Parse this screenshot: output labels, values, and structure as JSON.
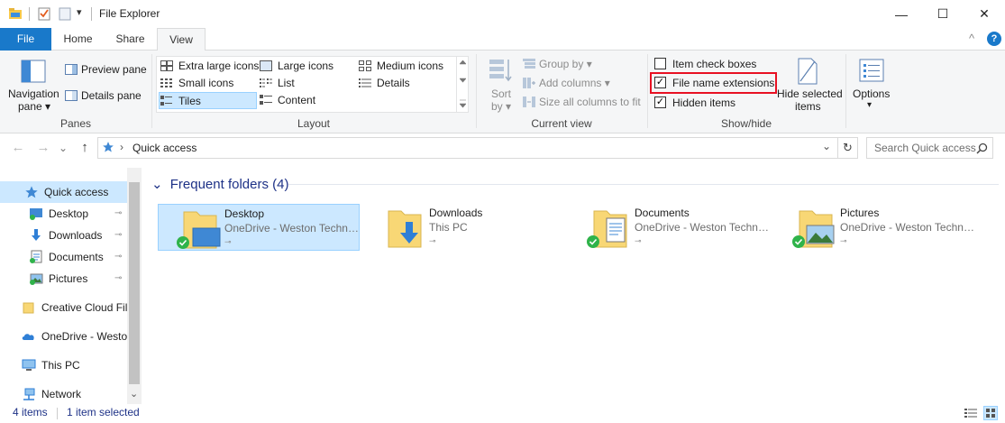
{
  "window": {
    "title": "File Explorer",
    "minimize": "—",
    "maximize": "☐",
    "close": "✕",
    "qat_dropdown": "▾"
  },
  "tabs": {
    "file": "File",
    "home": "Home",
    "share": "Share",
    "view": "View",
    "collapse": "^",
    "help": "?"
  },
  "ribbon": {
    "panes": {
      "navigation_pane_line1": "Navigation",
      "navigation_pane_line2": "pane ▾",
      "preview_pane": "Preview pane",
      "details_pane": "Details pane",
      "group_label": "Panes"
    },
    "layout": {
      "extra_large_icons": "Extra large icons",
      "large_icons": "Large icons",
      "medium_icons": "Medium icons",
      "small_icons": "Small icons",
      "list": "List",
      "details": "Details",
      "tiles": "Tiles",
      "content": "Content",
      "group_label": "Layout"
    },
    "current_view": {
      "sort_by_line1": "Sort",
      "sort_by_line2": "by ▾",
      "group_by": "Group by ▾",
      "add_columns": "Add columns ▾",
      "size_all_columns": "Size all columns to fit",
      "group_label": "Current view"
    },
    "show_hide": {
      "item_check_boxes": "Item check boxes",
      "item_check_boxes_checked": false,
      "file_name_extensions": "File name extensions",
      "file_name_extensions_checked": true,
      "hidden_items": "Hidden items",
      "hidden_items_checked": true,
      "hide_selected_line1": "Hide selected",
      "hide_selected_line2": "items",
      "group_label": "Show/hide",
      "highlight_color": "#e81123"
    },
    "options": {
      "label": "Options",
      "arrow": "▾"
    }
  },
  "address_bar": {
    "back": "←",
    "forward": "→",
    "recent": "⌄",
    "up": "↑",
    "path_separator": "›",
    "path": "Quick access",
    "dropdown": "⌄",
    "refresh": "↻",
    "search_placeholder": "Search Quick access"
  },
  "sidebar": {
    "items": [
      {
        "label": "Quick access",
        "icon": "star-icon"
      },
      {
        "label": "Desktop",
        "icon": "desktop-icon",
        "pinned": true
      },
      {
        "label": "Downloads",
        "icon": "download-icon",
        "pinned": true
      },
      {
        "label": "Documents",
        "icon": "documents-icon",
        "pinned": true
      },
      {
        "label": "Pictures",
        "icon": "pictures-icon",
        "pinned": true
      },
      {
        "label": "Creative Cloud Fil",
        "icon": "folder-icon"
      },
      {
        "label": "OneDrive - Westo",
        "icon": "onedrive-icon"
      },
      {
        "label": "This PC",
        "icon": "pc-icon"
      },
      {
        "label": "Network",
        "icon": "network-icon"
      }
    ],
    "pin_glyph": "📌",
    "expand_glyph": "⌄"
  },
  "content": {
    "section_toggle": "⌄",
    "section_title": "Frequent folders (4)",
    "folders": [
      {
        "name": "Desktop",
        "location": "OneDrive - Weston Techn…",
        "selected": true
      },
      {
        "name": "Downloads",
        "location": "This PC",
        "selected": false
      },
      {
        "name": "Documents",
        "location": "OneDrive - Weston Techn…",
        "selected": false
      },
      {
        "name": "Pictures",
        "location": "OneDrive - Weston Techn…",
        "selected": false
      }
    ]
  },
  "status_bar": {
    "items_count": "4 items",
    "selection": "1 item selected"
  },
  "colors": {
    "accent": "#1979ca",
    "selection_bg": "#cce8ff",
    "selection_border": "#99d1ff",
    "folder_yellow": "#f8d775",
    "sync_green": "#2fb34a"
  }
}
